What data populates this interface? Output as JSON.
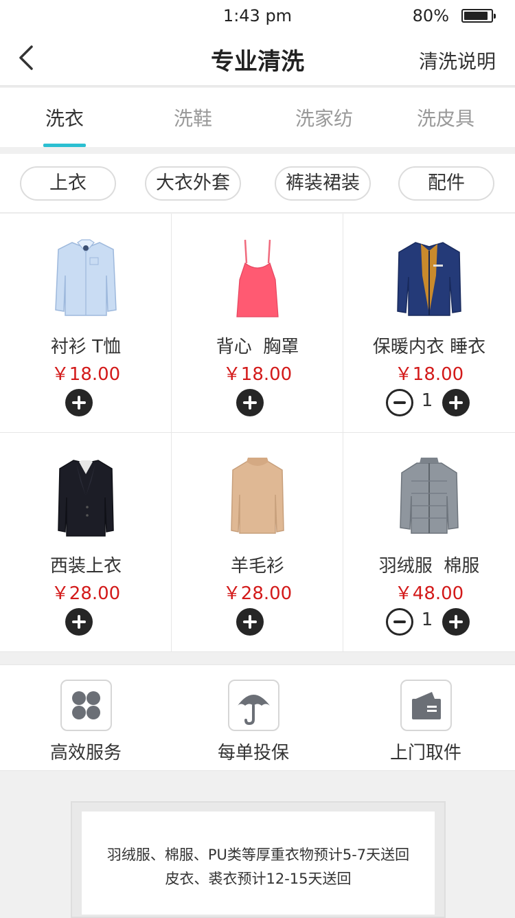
{
  "status": {
    "time": "1:43 pm",
    "battery": "80%"
  },
  "nav": {
    "title": "专业清洗",
    "right": "清洗说明"
  },
  "tabs": [
    {
      "label": "洗衣",
      "active": true
    },
    {
      "label": "洗鞋",
      "active": false
    },
    {
      "label": "洗家纺",
      "active": false
    },
    {
      "label": "洗皮具",
      "active": false
    }
  ],
  "chips": [
    "上衣",
    "大衣外套",
    "裤装裙装",
    "配件"
  ],
  "products": [
    {
      "name": "衬衫 T恤",
      "price": "￥18.00",
      "qty": null,
      "image": "shirt"
    },
    {
      "name": "背心  胸罩",
      "price": "￥18.00",
      "qty": null,
      "image": "camisole"
    },
    {
      "name": "保暖内衣 睡衣",
      "price": "￥18.00",
      "qty": "1",
      "image": "jacket"
    },
    {
      "name": "西装上衣",
      "price": "￥28.00",
      "qty": null,
      "image": "suit"
    },
    {
      "name": "羊毛衫",
      "price": "￥28.00",
      "qty": null,
      "image": "sweater"
    },
    {
      "name": "羽绒服  棉服",
      "price": "￥48.00",
      "qty": "1",
      "image": "down-jacket"
    }
  ],
  "features": [
    {
      "label": "高效服务",
      "icon": "clover-icon"
    },
    {
      "label": "每单投保",
      "icon": "umbrella-icon"
    },
    {
      "label": "上门取件",
      "icon": "wallet-icon"
    }
  ],
  "notice": {
    "line1": "羽绒服、棉服、PU类等厚重衣物预计5-7天送回",
    "line2": "皮衣、裘衣预计12-15天送回"
  },
  "colors": {
    "accent": "#2bbfd1",
    "price": "#d31a1a",
    "control": "#262626"
  }
}
